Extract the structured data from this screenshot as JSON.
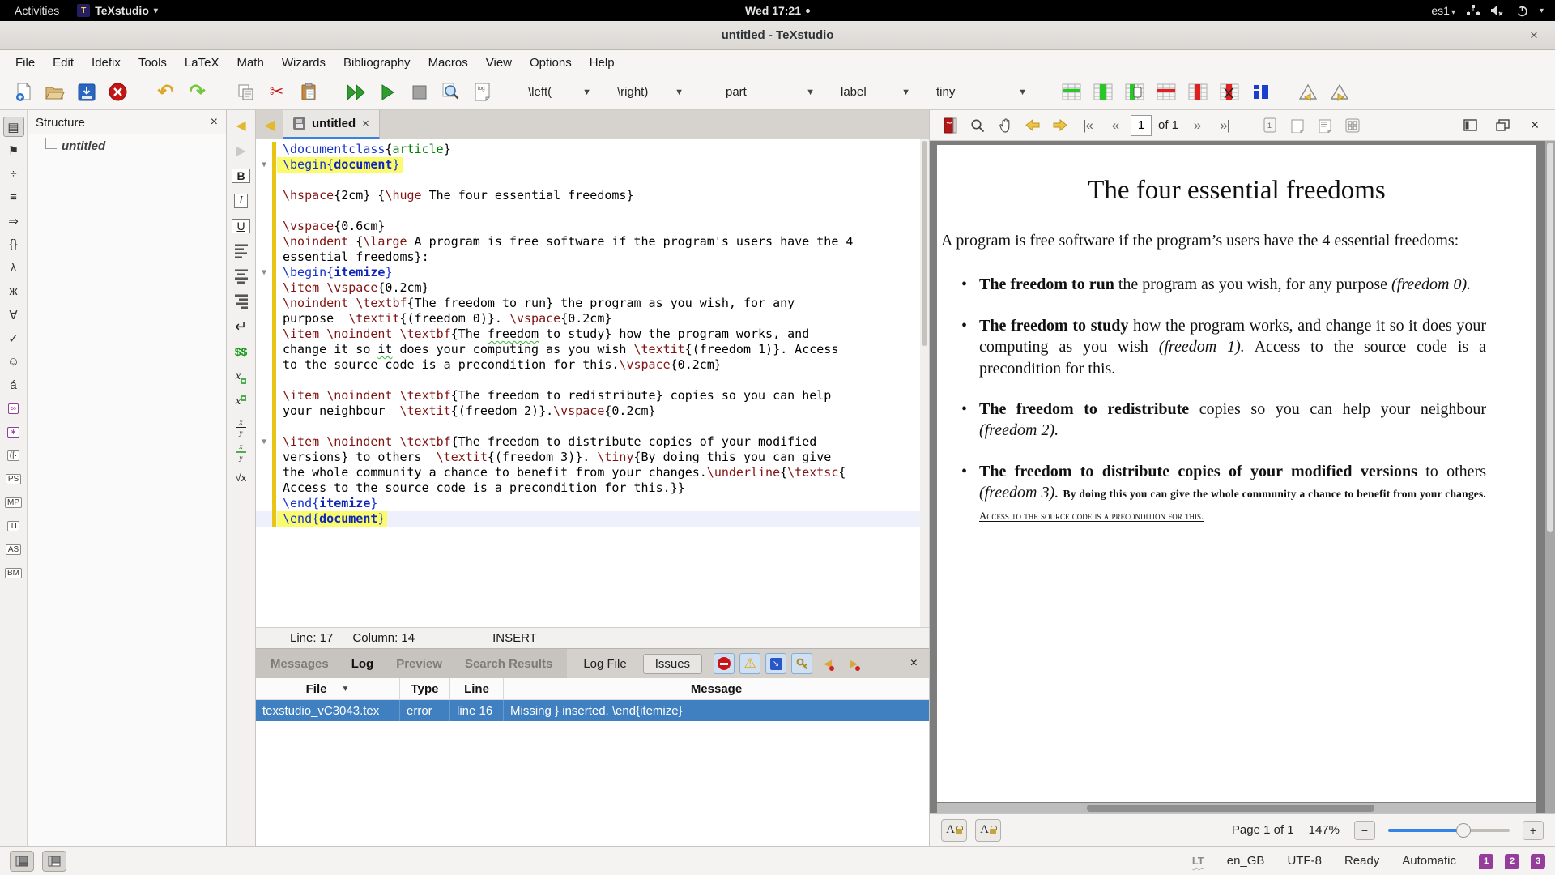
{
  "topbar": {
    "activities": "Activities",
    "app_name": "TeXstudio",
    "clock": "Wed 17:21",
    "keyboard_layout": "es1"
  },
  "titlebar": {
    "title": "untitled - TeXstudio"
  },
  "menubar": {
    "items": [
      "File",
      "Edit",
      "Idefix",
      "Tools",
      "LaTeX",
      "Math",
      "Wizards",
      "Bibliography",
      "Macros",
      "View",
      "Options",
      "Help"
    ]
  },
  "toolbar": {
    "left_delimiter": "\\left(",
    "right_delimiter": "\\right)",
    "sectioning": "part",
    "reference": "label",
    "font_size": "tiny"
  },
  "side_panel": {
    "icons": [
      {
        "name": "structure-panel-icon",
        "glyph": "▤",
        "selected": true
      },
      {
        "name": "bookmarks-panel-icon",
        "glyph": "⚑"
      },
      {
        "name": "math-operators-icon",
        "glyph": "÷"
      },
      {
        "name": "relations-icon",
        "glyph": "≡"
      },
      {
        "name": "arrows-icon",
        "glyph": "⇒"
      },
      {
        "name": "delimiters-icon",
        "glyph": "{}"
      },
      {
        "name": "greek-letters-icon",
        "glyph": "λ"
      },
      {
        "name": "cyrillic-icon",
        "glyph": "ж"
      },
      {
        "name": "operators-icon",
        "glyph": "∀"
      },
      {
        "name": "check-symbols-icon",
        "glyph": "✓"
      },
      {
        "name": "misc-symbols-icon",
        "glyph": "☺"
      },
      {
        "name": "accents-icon",
        "glyph": "á"
      },
      {
        "name": "infinity-symbols-icon",
        "glyph": "∞",
        "boxed": true,
        "purple": true
      },
      {
        "name": "special-symbols-icon",
        "glyph": "∗",
        "boxed": true,
        "purple": true
      },
      {
        "name": "left-delimiters-icon",
        "glyph": "([·",
        "boxed": true
      },
      {
        "name": "pstricks-icon",
        "glyph": "PS",
        "boxed": true
      },
      {
        "name": "metapost-icon",
        "glyph": "MP",
        "boxed": true
      },
      {
        "name": "tikz-icon",
        "glyph": "TI",
        "boxed": true
      },
      {
        "name": "asymptote-icon",
        "glyph": "AS",
        "boxed": true
      },
      {
        "name": "beamer-icon",
        "glyph": "BM",
        "boxed": true
      }
    ]
  },
  "structure_panel": {
    "title": "Structure",
    "root_item": "untitled"
  },
  "format_strip": {
    "icons": [
      {
        "name": "previous-change-icon",
        "kind": "glyph",
        "glyph": "◀",
        "color": "#e3b72e",
        "size": "16px"
      },
      {
        "name": "next-change-icon",
        "kind": "glyph",
        "glyph": "▶",
        "color": "#c9c9c9",
        "size": "16px"
      },
      {
        "name": "bold-icon",
        "kind": "boxed",
        "glyph": "B",
        "weight": "bold"
      },
      {
        "name": "italic-icon",
        "kind": "boxed",
        "glyph": "I",
        "style": "italic",
        "serif": true
      },
      {
        "name": "underline-icon",
        "kind": "boxed",
        "glyph": "U",
        "underline": true
      },
      {
        "name": "align-left-icon",
        "kind": "bars",
        "align": "l"
      },
      {
        "name": "align-center-icon",
        "kind": "bars",
        "align": "c"
      },
      {
        "name": "align-right-icon",
        "kind": "bars",
        "align": "r"
      },
      {
        "name": "newline-icon",
        "kind": "glyph",
        "glyph": "↵",
        "color": "#222",
        "size": "18px"
      },
      {
        "name": "math-mode-icon",
        "kind": "glyph",
        "glyph": "$$",
        "color": "#1a9a1a",
        "size": "14px",
        "weight": "bold"
      },
      {
        "name": "subscript-icon",
        "kind": "sub"
      },
      {
        "name": "superscript-icon",
        "kind": "sup"
      },
      {
        "name": "fraction-icon",
        "kind": "frac"
      },
      {
        "name": "dfrac-icon",
        "kind": "dfrac"
      },
      {
        "name": "sqrt-icon",
        "kind": "glyph",
        "glyph": "√x",
        "color": "#222",
        "size": "13px"
      }
    ]
  },
  "editor": {
    "tab_label": "untitled",
    "statusline": {
      "line": "Line: 17",
      "column": "Column: 14",
      "mode": "INSERT"
    },
    "lines": [
      {
        "tk": [
          [
            "k",
            "\\documentclass"
          ],
          [
            "t",
            "{"
          ],
          [
            "g",
            "article"
          ],
          [
            "t",
            "}"
          ]
        ]
      },
      {
        "f": 1,
        "h": 1,
        "tk": [
          [
            "k",
            "\\begin{"
          ],
          [
            "e",
            "document"
          ],
          [
            "k",
            "}"
          ]
        ]
      },
      {
        "tk": []
      },
      {
        "tk": [
          [
            "c",
            "\\hspace"
          ],
          [
            "t",
            "{2cm} {"
          ],
          [
            "c",
            "\\huge"
          ],
          [
            "t",
            " The four essential freedoms}"
          ]
        ]
      },
      {
        "tk": []
      },
      {
        "tk": [
          [
            "c",
            "\\vspace"
          ],
          [
            "t",
            "{0.6cm}"
          ]
        ]
      },
      {
        "tk": [
          [
            "c",
            "\\noindent"
          ],
          [
            "t",
            " {"
          ],
          [
            "c",
            "\\large"
          ],
          [
            "t",
            " A program is free software if the program's users have the 4"
          ]
        ]
      },
      {
        "tk": [
          [
            "t",
            "essential freedoms}:"
          ]
        ]
      },
      {
        "f": 1,
        "tk": [
          [
            "k",
            "\\begin{"
          ],
          [
            "e",
            "itemize"
          ],
          [
            "k",
            "}"
          ]
        ]
      },
      {
        "tk": [
          [
            "c",
            "\\item"
          ],
          [
            "t",
            " "
          ],
          [
            "c",
            "\\vspace"
          ],
          [
            "t",
            "{0.2cm}"
          ]
        ]
      },
      {
        "tk": [
          [
            "c",
            "\\noindent"
          ],
          [
            "t",
            " "
          ],
          [
            "c",
            "\\textbf"
          ],
          [
            "t",
            "{The freedom to run} the program as you wish, for any"
          ]
        ]
      },
      {
        "tk": [
          [
            "t",
            "purpose  "
          ],
          [
            "c",
            "\\textit"
          ],
          [
            "t",
            "{(freedom 0)}. "
          ],
          [
            "c",
            "\\vspace"
          ],
          [
            "t",
            "{0.2cm}"
          ]
        ]
      },
      {
        "tk": [
          [
            "c",
            "\\item"
          ],
          [
            "t",
            " "
          ],
          [
            "c",
            "\\noindent"
          ],
          [
            "t",
            " "
          ],
          [
            "c",
            "\\textbf"
          ],
          [
            "t",
            "{The "
          ],
          [
            "s",
            "freedom"
          ],
          [
            "t",
            " to study} how the program works, and"
          ]
        ]
      },
      {
        "tk": [
          [
            "t",
            "change it so "
          ],
          [
            "s",
            "it"
          ],
          [
            "t",
            " does your computing as you wish "
          ],
          [
            "c",
            "\\textit"
          ],
          [
            "t",
            "{(freedom 1)}. Access"
          ]
        ]
      },
      {
        "tk": [
          [
            "t",
            "to the source code is a precondition for this."
          ],
          [
            "c",
            "\\vspace"
          ],
          [
            "t",
            "{0.2cm}"
          ]
        ]
      },
      {
        "tk": []
      },
      {
        "tk": [
          [
            "c",
            "\\item"
          ],
          [
            "t",
            " "
          ],
          [
            "c",
            "\\noindent"
          ],
          [
            "t",
            " "
          ],
          [
            "c",
            "\\textbf"
          ],
          [
            "t",
            "{The freedom to redistribute} copies so you can help"
          ]
        ]
      },
      {
        "tk": [
          [
            "t",
            "your neighbour  "
          ],
          [
            "c",
            "\\textit"
          ],
          [
            "t",
            "{(freedom 2)}."
          ],
          [
            "c",
            "\\vspace"
          ],
          [
            "t",
            "{0.2cm}"
          ]
        ]
      },
      {
        "tk": []
      },
      {
        "f": 1,
        "tk": [
          [
            "c",
            "\\item"
          ],
          [
            "t",
            " "
          ],
          [
            "c",
            "\\noindent"
          ],
          [
            "t",
            " "
          ],
          [
            "c",
            "\\textbf"
          ],
          [
            "t",
            "{The freedom to distribute copies of your modified"
          ]
        ]
      },
      {
        "tk": [
          [
            "t",
            "versions} to others  "
          ],
          [
            "c",
            "\\textit"
          ],
          [
            "t",
            "{(freedom 3)}. "
          ],
          [
            "c",
            "\\tiny"
          ],
          [
            "t",
            "{By doing this you can give"
          ]
        ]
      },
      {
        "tk": [
          [
            "t",
            "the whole community a chance to benefit from your changes."
          ],
          [
            "c",
            "\\underline"
          ],
          [
            "t",
            "{"
          ],
          [
            "c",
            "\\textsc"
          ],
          [
            "t",
            "{"
          ]
        ]
      },
      {
        "tk": [
          [
            "t",
            "Access to the source code is a precondition for this.}}"
          ]
        ]
      },
      {
        "tk": [
          [
            "k",
            "\\end{"
          ],
          [
            "e",
            "itemize"
          ],
          [
            "k",
            "}"
          ]
        ]
      },
      {
        "h": 1,
        "cl": 1,
        "tk": [
          [
            "k",
            "\\end{"
          ],
          [
            "e",
            "document"
          ],
          [
            "k",
            "}"
          ]
        ]
      }
    ]
  },
  "log_panel": {
    "tabs": [
      {
        "label": "Messages",
        "active": false
      },
      {
        "label": "Log",
        "active": true
      },
      {
        "label": "Preview",
        "active": false
      },
      {
        "label": "Search Results",
        "active": false
      }
    ],
    "log_file_label": "Log File",
    "issues_label": "Issues",
    "table": {
      "headers": [
        {
          "label": "File",
          "sort": true,
          "w": "w-file"
        },
        {
          "label": "Type",
          "w": "w-type"
        },
        {
          "label": "Line",
          "w": "w-line"
        },
        {
          "label": "Message",
          "w": "w-msg"
        }
      ],
      "rows": [
        {
          "selected": true,
          "cells": [
            {
              "text": "texstudio_vC3043.tex",
              "w": "w-file"
            },
            {
              "text": "error",
              "w": "w-type"
            },
            {
              "text": "line 16",
              "w": "w-line"
            },
            {
              "text": "Missing } inserted. \\end{itemize}",
              "w": "w-msg"
            }
          ]
        }
      ]
    }
  },
  "pdf": {
    "toolbar": {
      "page_input": "1",
      "of_label": "of 1"
    },
    "document": {
      "title": "The four essential freedoms",
      "intro": "A program is free software if the program’s users have the 4 essential freedoms:",
      "bullets": [
        [
          {
            "s": "b",
            "t": "The freedom to run"
          },
          {
            "s": "n",
            "t": " the program as you wish, for any purpose "
          },
          {
            "s": "i",
            "t": "(freedom 0)."
          }
        ],
        [
          {
            "s": "b",
            "t": "The freedom to study"
          },
          {
            "s": "n",
            "t": " how the program works, and change it so it does your computing as you wish "
          },
          {
            "s": "i",
            "t": "(freedom 1)."
          },
          {
            "s": "n",
            "t": " Access to the source code is a precondition for this."
          }
        ],
        [
          {
            "s": "b",
            "t": "The freedom to redistribute"
          },
          {
            "s": "n",
            "t": " copies so you can help your neighbour "
          },
          {
            "s": "i",
            "t": "(freedom 2)."
          }
        ],
        [
          {
            "s": "b",
            "t": "The freedom to distribute copies of your modified versions"
          },
          {
            "s": "n",
            "t": " to others "
          },
          {
            "s": "i",
            "t": "(freedom 3)."
          },
          {
            "s": "n",
            "t": " "
          },
          {
            "s": "ty",
            "t": "By doing this you can give the whole community a chance to benefit from your changes. "
          },
          {
            "s": "tysc",
            "t": "Access to the source code is a precondition for this."
          }
        ]
      ]
    },
    "bottom": {
      "page_info": "Page 1 of 1",
      "zoom": "147%"
    }
  },
  "statusbar": {
    "language_tool": "LT",
    "language": "en_GB",
    "encoding": "UTF-8",
    "status": "Ready",
    "line_ending": "Automatic",
    "bookmarks": [
      "1",
      "2",
      "3"
    ]
  }
}
